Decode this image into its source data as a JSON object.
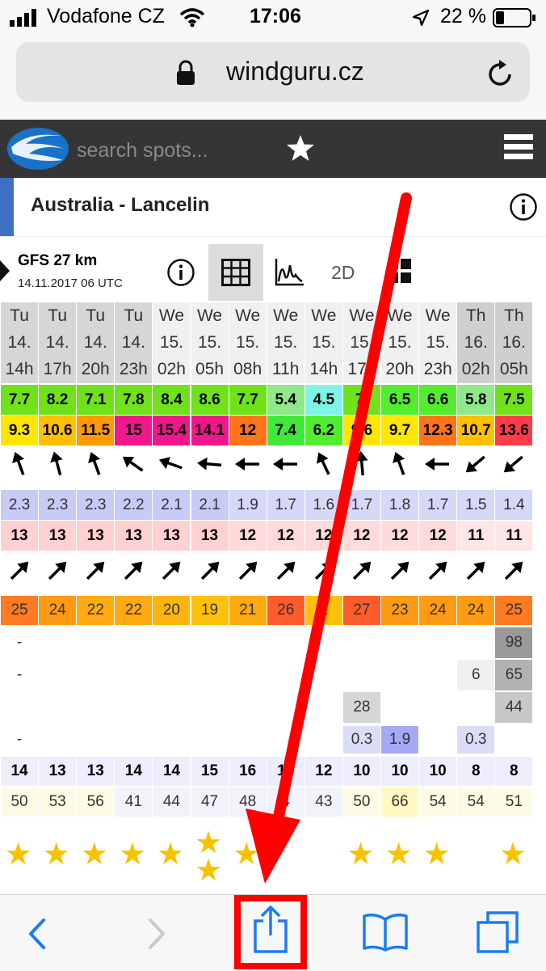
{
  "status": {
    "carrier": "Vodafone CZ",
    "time": "17:06",
    "battery": "22 %"
  },
  "browser": {
    "url": "windguru.cz"
  },
  "site": {
    "search_placeholder": "search spots..."
  },
  "spot": {
    "name": "Australia - Lancelin"
  },
  "model": {
    "name": "GFS 27 km",
    "date": "14.11.2017 06 UTC",
    "view_2d": "2D"
  },
  "forecast": {
    "days": [
      "Tu",
      "Tu",
      "Tu",
      "Tu",
      "We",
      "We",
      "We",
      "We",
      "We",
      "We",
      "We",
      "We",
      "Th",
      "Th"
    ],
    "dates": [
      "14.",
      "14.",
      "14.",
      "14.",
      "15.",
      "15.",
      "15.",
      "15.",
      "15.",
      "15.",
      "15.",
      "15.",
      "16.",
      "16."
    ],
    "hours": [
      "14h",
      "17h",
      "20h",
      "23h",
      "02h",
      "05h",
      "08h",
      "11h",
      "14h",
      "17h",
      "20h",
      "23h",
      "02h",
      "05h"
    ],
    "wind_speed": [
      "7.7",
      "8.2",
      "7.1",
      "7.8",
      "8.4",
      "8.6",
      "7.7",
      "5.4",
      "4.5",
      "7.",
      "6.5",
      "6.6",
      "5.8",
      "7.5"
    ],
    "wind_gusts": [
      "9.3",
      "10.6",
      "11.5",
      "15",
      "15.4",
      "14.1",
      "12",
      "7.4",
      "6.2",
      "9.6",
      "9.7",
      "12.3",
      "10.7",
      "13.6"
    ],
    "wind_dir_deg": [
      160,
      165,
      160,
      125,
      110,
      95,
      90,
      90,
      155,
      175,
      160,
      90,
      50,
      50
    ],
    "wave_height": [
      "2.3",
      "2.3",
      "2.3",
      "2.2",
      "2.1",
      "2.1",
      "1.9",
      "1.7",
      "1.6",
      "1.7",
      "1.8",
      "1.7",
      "1.5",
      "1.4"
    ],
    "wave_period": [
      "13",
      "13",
      "13",
      "13",
      "13",
      "13",
      "12",
      "12",
      "12",
      "12",
      "12",
      "12",
      "11",
      "11"
    ],
    "wave_dir_deg": [
      225,
      225,
      225,
      225,
      225,
      225,
      225,
      225,
      225,
      225,
      225,
      225,
      225,
      225
    ],
    "temperature": [
      "25",
      "24",
      "22",
      "22",
      "20",
      "19",
      "21",
      "26",
      "2",
      "27",
      "23",
      "24",
      "24",
      "25"
    ],
    "cloud_high": [
      "-",
      "",
      "",
      "",
      "",
      "",
      "",
      "",
      "",
      "",
      "",
      "",
      "",
      "98"
    ],
    "cloud_mid": [
      "-",
      "",
      "",
      "",
      "",
      "",
      "",
      "",
      "",
      "",
      "",
      "",
      "6",
      "65"
    ],
    "cloud_low": [
      "",
      "",
      "",
      "",
      "",
      "",
      "",
      "",
      "",
      "28",
      "",
      "",
      "",
      "44"
    ],
    "precipitation": [
      "-",
      "",
      "",
      "",
      "",
      "",
      "",
      "",
      "",
      "0.3",
      "1.9",
      "",
      "0.3",
      ""
    ],
    "rating_value": [
      "14",
      "13",
      "13",
      "14",
      "14",
      "15",
      "16",
      "15",
      "12",
      "10",
      "10",
      "10",
      "8",
      "8"
    ],
    "humidity": [
      "50",
      "53",
      "56",
      "41",
      "44",
      "47",
      "48",
      "4",
      "43",
      "50",
      "66",
      "54",
      "54",
      "51"
    ],
    "stars": [
      1,
      1,
      1,
      1,
      1,
      2,
      1,
      0,
      0,
      1,
      1,
      1,
      0,
      1
    ]
  },
  "colors": {
    "accent_blue": "#3d6fc3",
    "annotation_red": "#ff0000",
    "ios_blue": "#1a7cf5",
    "star_yellow": "#f7c300"
  }
}
